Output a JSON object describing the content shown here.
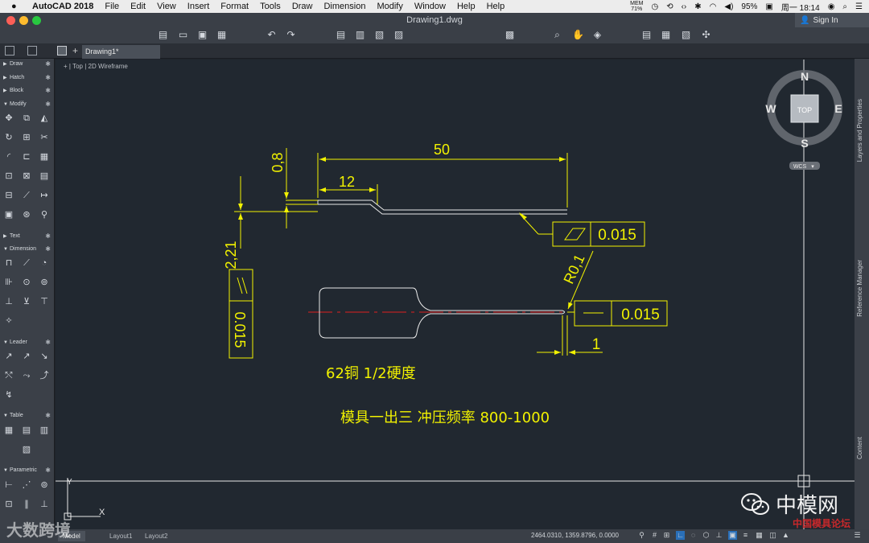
{
  "menubar": {
    "app_name": "AutoCAD 2018",
    "menus": [
      "File",
      "Edit",
      "View",
      "Insert",
      "Format",
      "Tools",
      "Draw",
      "Dimension",
      "Modify",
      "Window",
      "Help",
      "Help"
    ],
    "mem_label": "MEM",
    "mem_value": "71%",
    "battery": "95%",
    "clock": "周一 18:14"
  },
  "window": {
    "title": "Drawing1.dwg",
    "sign_in": "Sign In",
    "doc_tab": "Drawing1*"
  },
  "viewport": {
    "label_view": "Top",
    "label_style": "2D Wireframe"
  },
  "viewcube": {
    "n": "N",
    "s": "S",
    "e": "E",
    "w": "W",
    "face": "TOP",
    "wcs": "WCS"
  },
  "palette": {
    "sections": [
      "Draw",
      "Hatch",
      "Block",
      "Modify",
      "Text",
      "Dimension",
      "Leader",
      "Table",
      "Parametric"
    ]
  },
  "right_panels": [
    "Layers and Properties",
    "Reference Manager",
    "Content"
  ],
  "drawing": {
    "dim_50": "50",
    "dim_12": "12",
    "dim_08": "0,8",
    "dim_221": "2,21",
    "tol_top": "0.015",
    "tol_left": "0.015",
    "tol_bottom": "0.015",
    "radius": "R0,1",
    "dim_1": "1",
    "material": "62铜 1/2硬度",
    "note": "模具一出三 冲压频率 800-1000",
    "ucs_x": "X",
    "ucs_y": "Y",
    "colors": {
      "annotation": "#f2f200",
      "geometry": "#e8e8e8",
      "centerline": "#e02020"
    }
  },
  "statusbar": {
    "tabs": [
      "Model",
      "Layout1",
      "Layout2"
    ],
    "coords": "2464.0310, 1359.8796, 0.0000"
  },
  "watermarks": {
    "left": "大数跨境",
    "right": "中模网",
    "right_small": "中国模具论坛"
  }
}
